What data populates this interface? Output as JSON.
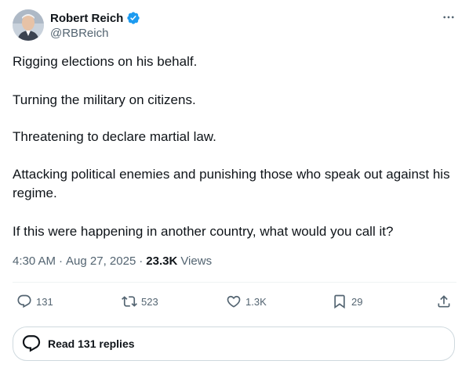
{
  "author": {
    "name": "Robert Reich",
    "handle": "@RBReich",
    "verified": true,
    "badge_color": "#1d9bf0"
  },
  "tweet": {
    "lines": [
      "Rigging elections on his behalf.",
      "Turning the military on citizens.",
      "Threatening to declare martial law.",
      "Attacking political enemies and punishing those who speak out against his regime.",
      "If this were happening in another country, what would you call it?"
    ],
    "time": "4:30 AM",
    "date": "Aug 27, 2025",
    "views_count": "23.3K",
    "views_label": "Views"
  },
  "actions": {
    "reply_count": "131",
    "retweet_count": "523",
    "like_count": "1.3K",
    "bookmark_count": "29"
  },
  "replies_button": {
    "label": "Read 131 replies"
  },
  "colors": {
    "text": "#0f1419",
    "secondary": "#536471",
    "border": "#cfd9de",
    "divider": "#eff3f4"
  }
}
